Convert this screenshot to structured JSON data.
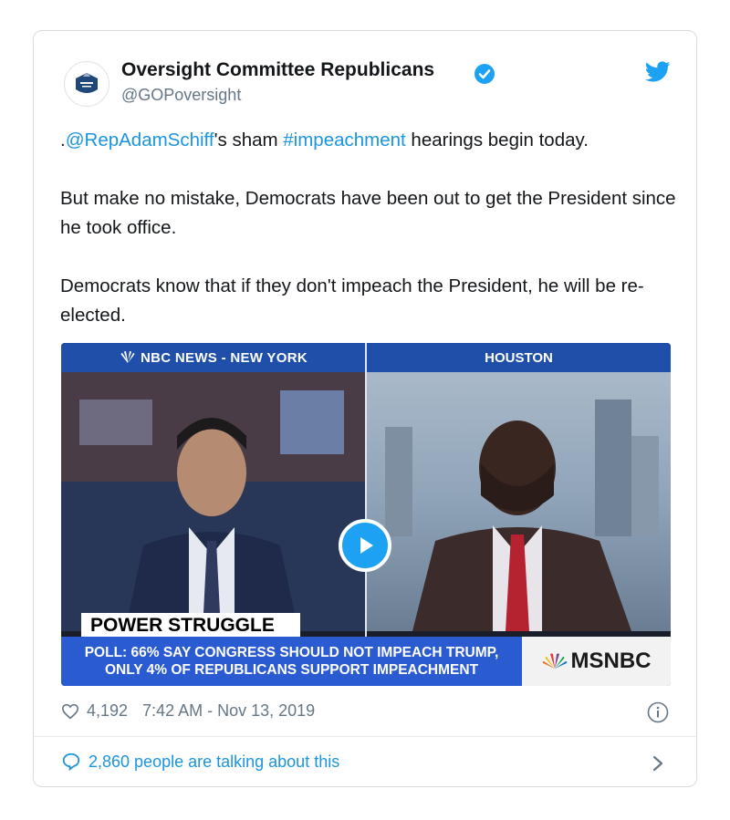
{
  "tweet": {
    "author_name": "Oversight Committee Republicans",
    "author_handle": "@GOPoversight",
    "text": {
      "line1_prefix": ".",
      "mention": "@RepAdamSchiff",
      "line1_mid": "'s sham ",
      "hashtag": "#impeachment",
      "line1_suffix": " hearings begin today.",
      "para2": "But make no mistake, Democrats have been out to get the President since he took office.",
      "para3": "Democrats know that if they don't impeach the President, he will be re-elected."
    },
    "likes": "4,192",
    "timestamp": "7:42 AM - Nov 13, 2019",
    "talking": "2,860 people are talking about this"
  },
  "video": {
    "left_header": "NBC NEWS - NEW YORK",
    "right_header": "HOUSTON",
    "lower_third": "POWER STRUGGLE",
    "ticker_line1": "POLL: 66% SAY CONGRESS SHOULD NOT IMPEACH TRUMP,",
    "ticker_line2": "ONLY 4% OF REPUBLICANS SUPPORT IMPEACHMENT",
    "network": "MSNBC"
  },
  "icons": {
    "verified": "verified-badge-icon",
    "bird": "twitter-bird-icon",
    "heart": "heart-icon",
    "info": "info-icon",
    "comment": "speech-bubble-icon",
    "chevron": "chevron-right-icon",
    "play": "play-icon"
  },
  "colors": {
    "link": "#1b95e0",
    "brand_blue": "#1da1f2",
    "muted": "#657786",
    "ticker_blue": "#2b5bd0"
  }
}
